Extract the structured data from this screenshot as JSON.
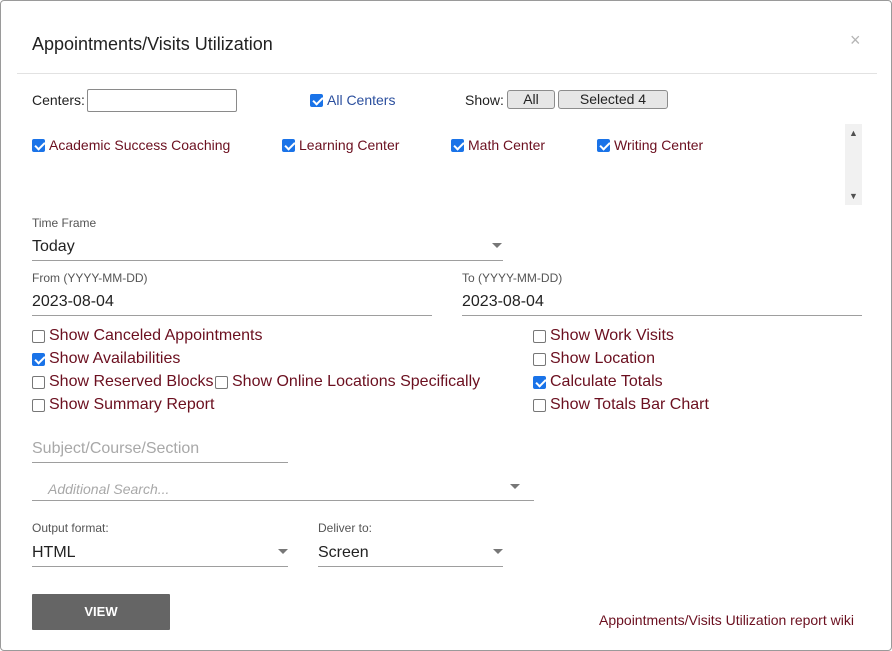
{
  "dialog": {
    "title": "Appointments/Visits Utilization",
    "close_glyph": "×"
  },
  "centers": {
    "label": "Centers:",
    "input_value": "",
    "all_centers_label": "All Centers",
    "all_centers_checked": true,
    "show_label": "Show:",
    "show_all_button": "All",
    "show_selected_button": "Selected 4",
    "items": [
      {
        "label": "Academic Success Coaching",
        "checked": true
      },
      {
        "label": "Learning Center",
        "checked": true
      },
      {
        "label": "Math Center",
        "checked": true
      },
      {
        "label": "Writing Center",
        "checked": true
      }
    ]
  },
  "time_frame": {
    "label": "Time Frame",
    "value": "Today"
  },
  "from": {
    "label": "From (YYYY-MM-DD)",
    "value": "2023-08-04"
  },
  "to": {
    "label": "To (YYYY-MM-DD)",
    "value": "2023-08-04"
  },
  "options": {
    "show_canceled": {
      "label": "Show Canceled Appointments",
      "checked": false
    },
    "show_availabilities": {
      "label": "Show Availabilities",
      "checked": true
    },
    "show_reserved_blocks": {
      "label": "Show Reserved Blocks",
      "checked": false
    },
    "show_online_locations": {
      "label": "Show Online Locations Specifically",
      "checked": false
    },
    "show_summary_report": {
      "label": "Show Summary Report",
      "checked": false
    },
    "show_work_visits": {
      "label": "Show Work Visits",
      "checked": false
    },
    "show_location": {
      "label": "Show Location",
      "checked": false
    },
    "calculate_totals": {
      "label": "Calculate Totals",
      "checked": true
    },
    "show_totals_bar_chart": {
      "label": "Show Totals Bar Chart",
      "checked": false
    }
  },
  "subject_search": {
    "placeholder": "Subject/Course/Section"
  },
  "additional_search": {
    "placeholder": "Additional Search..."
  },
  "output_format": {
    "label": "Output format:",
    "value": "HTML"
  },
  "deliver_to": {
    "label": "Deliver to:",
    "value": "Screen"
  },
  "actions": {
    "view_label": "VIEW",
    "wiki_link": "Appointments/Visits Utilization report wiki"
  },
  "colors": {
    "accent_checkbox": "#1a73e8",
    "label_maroon": "#6b0f1f",
    "view_button_bg": "#656565"
  }
}
